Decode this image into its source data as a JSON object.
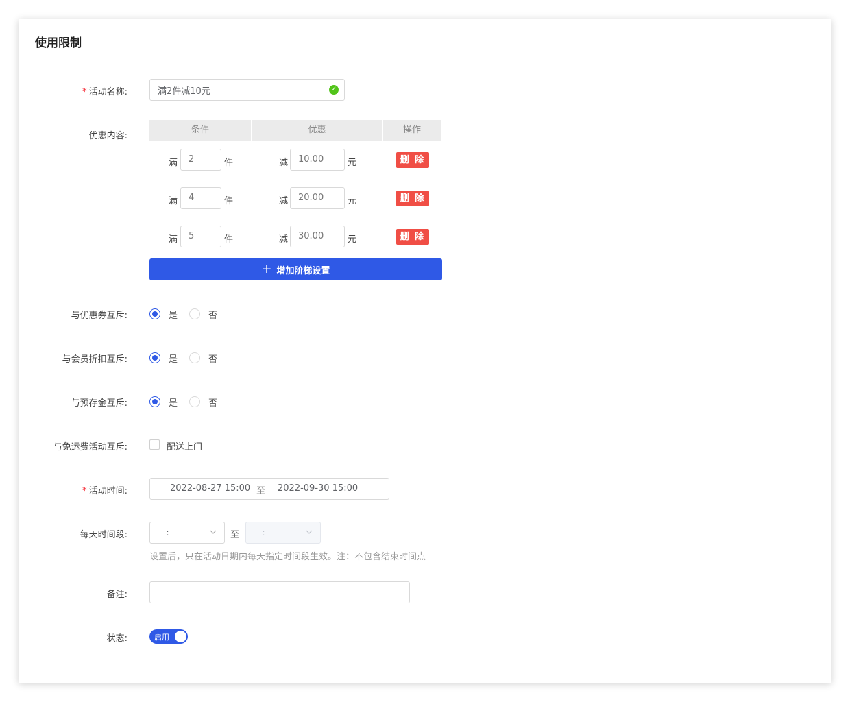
{
  "section_title": "使用限制",
  "colors": {
    "primary": "#2f59e6",
    "danger": "#f04e45",
    "success": "#52c41a",
    "required": "#f5222d"
  },
  "labels": {
    "activity_name": "活动名称:",
    "discount_content": "优惠内容:",
    "coupon_exclusive": "与优惠券互斥:",
    "member_exclusive": "与会员折扣互斥:",
    "prepaid_exclusive": "与预存金互斥:",
    "free_shipping_exclusive": "与免运费活动互斥:",
    "activity_time": "活动时间:",
    "daily_period": "每天时间段:",
    "remark": "备注:",
    "status": "状态:"
  },
  "activity_name_value": "满2件减10元",
  "table": {
    "headers": [
      "条件",
      "优惠",
      "操作"
    ],
    "rows": [
      {
        "prefix": "满",
        "count": "2",
        "unit": "件",
        "minus": "减",
        "amount": "10.00",
        "currency": "元",
        "action": "删 除"
      },
      {
        "prefix": "满",
        "count": "4",
        "unit": "件",
        "minus": "减",
        "amount": "20.00",
        "currency": "元",
        "action": "删 除"
      },
      {
        "prefix": "满",
        "count": "5",
        "unit": "件",
        "minus": "减",
        "amount": "30.00",
        "currency": "元",
        "action": "删 除"
      }
    ]
  },
  "add_tier_button": "增加阶梯设置",
  "yes": "是",
  "no": "否",
  "exclusive_selected": {
    "coupon": "是",
    "member": "是",
    "prepaid": "是"
  },
  "free_shipping_option": "配送上门",
  "free_shipping_checked": false,
  "time_range": {
    "start": "2022-08-27 15:00",
    "separator": "至",
    "end": "2022-09-30 15:00"
  },
  "daily": {
    "start_placeholder": "-- : --",
    "separator": "至",
    "end_placeholder": "-- : --"
  },
  "daily_hint": "设置后，只在活动日期内每天指定时间段生效。注：不包含结束时间点",
  "remark_value": "",
  "status_label": "启用",
  "status_on": true
}
